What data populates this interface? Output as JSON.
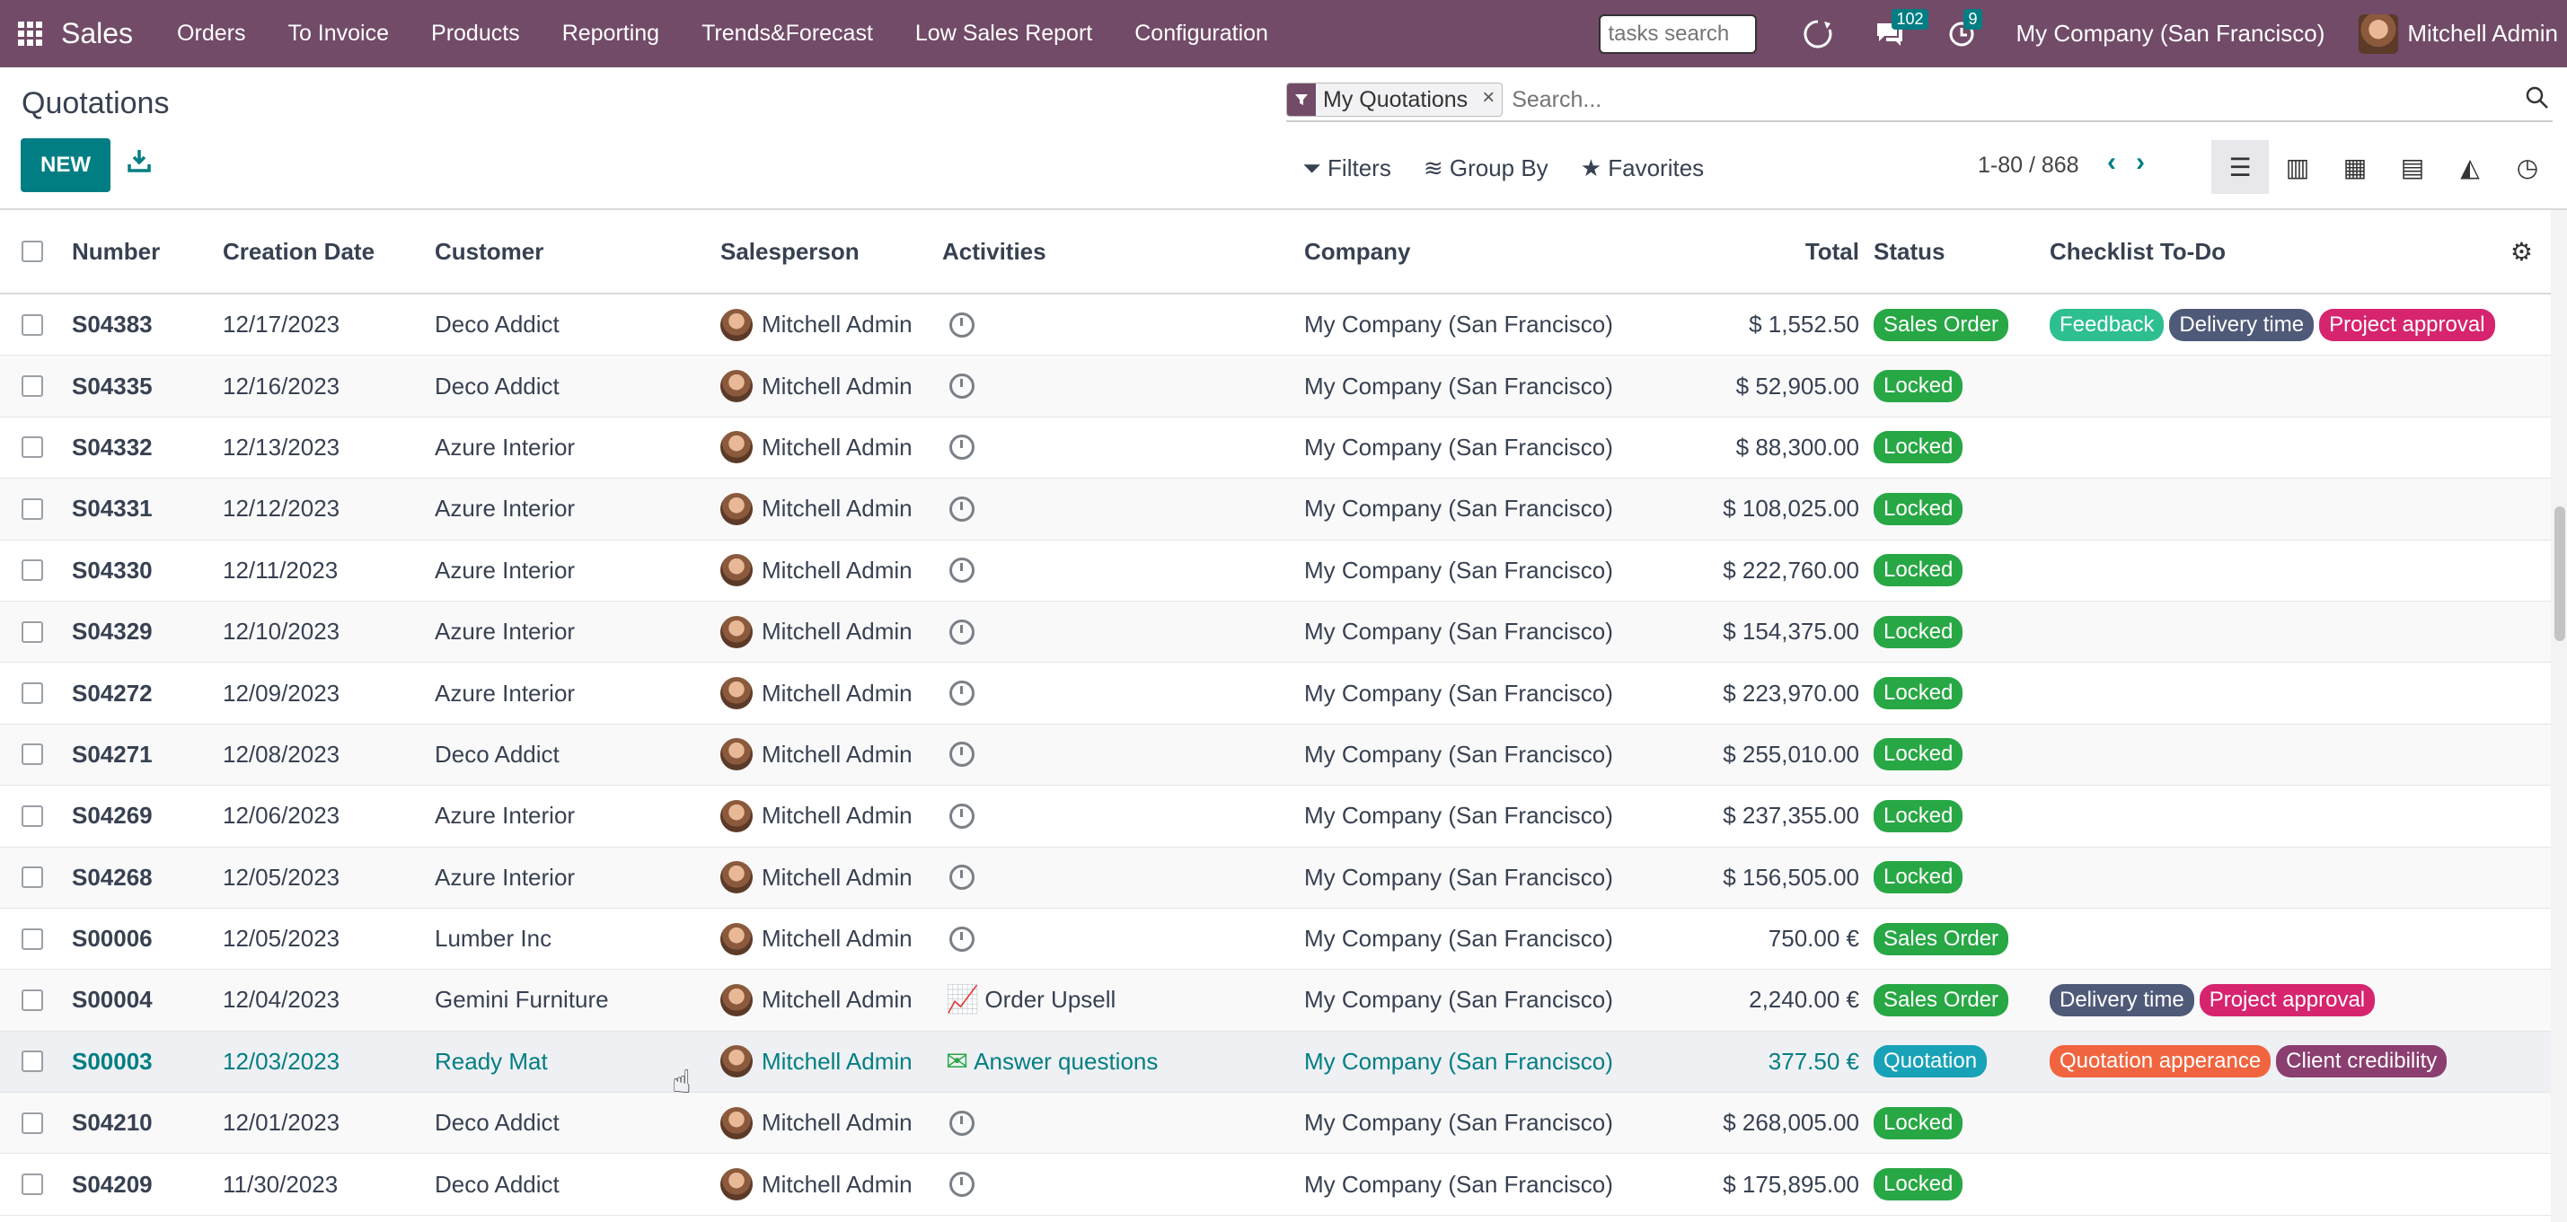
{
  "nav": {
    "brand": "Sales",
    "items": [
      "Orders",
      "To Invoice",
      "Products",
      "Reporting",
      "Trends&Forecast",
      "Low Sales Report",
      "Configuration"
    ],
    "tasks_search_placeholder": "tasks search",
    "messages_count": "102",
    "activities_count": "9",
    "company": "My Company (San Francisco)",
    "user": "Mitchell Admin"
  },
  "control": {
    "title": "Quotations",
    "new_label": "NEW",
    "facet_label": "My Quotations",
    "search_placeholder": "Search...",
    "filters_label": "Filters",
    "groupby_label": "Group By",
    "favorites_label": "Favorites",
    "pager": "1-80 / 868"
  },
  "table": {
    "headers": {
      "number": "Number",
      "date": "Creation Date",
      "customer": "Customer",
      "salesperson": "Salesperson",
      "activities": "Activities",
      "company": "Company",
      "total": "Total",
      "status": "Status",
      "checklist": "Checklist To-Do"
    },
    "rows": [
      {
        "number": "S04383",
        "date": "12/17/2023",
        "customer": "Deco Addict",
        "salesperson": "Mitchell Admin",
        "activity": "",
        "company": "My Company (San Francisco)",
        "total": "$ 1,552.50",
        "status": "Sales Order",
        "tags": [
          {
            "label": "Feedback",
            "color": "#2ebf91"
          },
          {
            "label": "Delivery time",
            "color": "#4f5a78"
          },
          {
            "label": "Project approval",
            "color": "#d6246e"
          }
        ]
      },
      {
        "number": "S04335",
        "date": "12/16/2023",
        "customer": "Deco Addict",
        "salesperson": "Mitchell Admin",
        "activity": "",
        "company": "My Company (San Francisco)",
        "total": "$ 52,905.00",
        "status": "Locked",
        "tags": []
      },
      {
        "number": "S04332",
        "date": "12/13/2023",
        "customer": "Azure Interior",
        "salesperson": "Mitchell Admin",
        "activity": "",
        "company": "My Company (San Francisco)",
        "total": "$ 88,300.00",
        "status": "Locked",
        "tags": []
      },
      {
        "number": "S04331",
        "date": "12/12/2023",
        "customer": "Azure Interior",
        "salesperson": "Mitchell Admin",
        "activity": "",
        "company": "My Company (San Francisco)",
        "total": "$ 108,025.00",
        "status": "Locked",
        "tags": []
      },
      {
        "number": "S04330",
        "date": "12/11/2023",
        "customer": "Azure Interior",
        "salesperson": "Mitchell Admin",
        "activity": "",
        "company": "My Company (San Francisco)",
        "total": "$ 222,760.00",
        "status": "Locked",
        "tags": []
      },
      {
        "number": "S04329",
        "date": "12/10/2023",
        "customer": "Azure Interior",
        "salesperson": "Mitchell Admin",
        "activity": "",
        "company": "My Company (San Francisco)",
        "total": "$ 154,375.00",
        "status": "Locked",
        "tags": []
      },
      {
        "number": "S04272",
        "date": "12/09/2023",
        "customer": "Azure Interior",
        "salesperson": "Mitchell Admin",
        "activity": "",
        "company": "My Company (San Francisco)",
        "total": "$ 223,970.00",
        "status": "Locked",
        "tags": []
      },
      {
        "number": "S04271",
        "date": "12/08/2023",
        "customer": "Deco Addict",
        "salesperson": "Mitchell Admin",
        "activity": "",
        "company": "My Company (San Francisco)",
        "total": "$ 255,010.00",
        "status": "Locked",
        "tags": []
      },
      {
        "number": "S04269",
        "date": "12/06/2023",
        "customer": "Azure Interior",
        "salesperson": "Mitchell Admin",
        "activity": "",
        "company": "My Company (San Francisco)",
        "total": "$ 237,355.00",
        "status": "Locked",
        "tags": []
      },
      {
        "number": "S04268",
        "date": "12/05/2023",
        "customer": "Azure Interior",
        "salesperson": "Mitchell Admin",
        "activity": "",
        "company": "My Company (San Francisco)",
        "total": "$ 156,505.00",
        "status": "Locked",
        "tags": []
      },
      {
        "number": "S00006",
        "date": "12/05/2023",
        "customer": "Lumber Inc",
        "salesperson": "Mitchell Admin",
        "activity": "",
        "company": "My Company (San Francisco)",
        "total": "750.00 €",
        "status": "Sales Order",
        "tags": []
      },
      {
        "number": "S00004",
        "date": "12/04/2023",
        "customer": "Gemini Furniture",
        "salesperson": "Mitchell Admin",
        "activity": "Order Upsell",
        "activity_type": "upsell",
        "company": "My Company (San Francisco)",
        "total": "2,240.00 €",
        "status": "Sales Order",
        "tags": [
          {
            "label": "Delivery time",
            "color": "#4f5a78"
          },
          {
            "label": "Project approval",
            "color": "#d6246e"
          }
        ]
      },
      {
        "number": "S00003",
        "date": "12/03/2023",
        "customer": "Ready Mat",
        "salesperson": "Mitchell Admin",
        "activity": "Answer questions",
        "activity_type": "mail",
        "company": "My Company (San Francisco)",
        "total": "377.50 €",
        "status": "Quotation",
        "highlight": true,
        "tags": [
          {
            "label": "Quotation apperance",
            "color": "#f0653f"
          },
          {
            "label": "Client credibility",
            "color": "#8b3e70"
          }
        ]
      },
      {
        "number": "S04210",
        "date": "12/01/2023",
        "customer": "Deco Addict",
        "salesperson": "Mitchell Admin",
        "activity": "",
        "company": "My Company (San Francisco)",
        "total": "$ 268,005.00",
        "status": "Locked",
        "tags": []
      },
      {
        "number": "S04209",
        "date": "11/30/2023",
        "customer": "Deco Addict",
        "salesperson": "Mitchell Admin",
        "activity": "",
        "company": "My Company (San Francisco)",
        "total": "$ 175,895.00",
        "status": "Locked",
        "tags": []
      }
    ]
  },
  "colors": {
    "brand": "#714B67",
    "accent": "#017E84",
    "status_green": "#28a745",
    "status_blue": "#17a2b8"
  }
}
